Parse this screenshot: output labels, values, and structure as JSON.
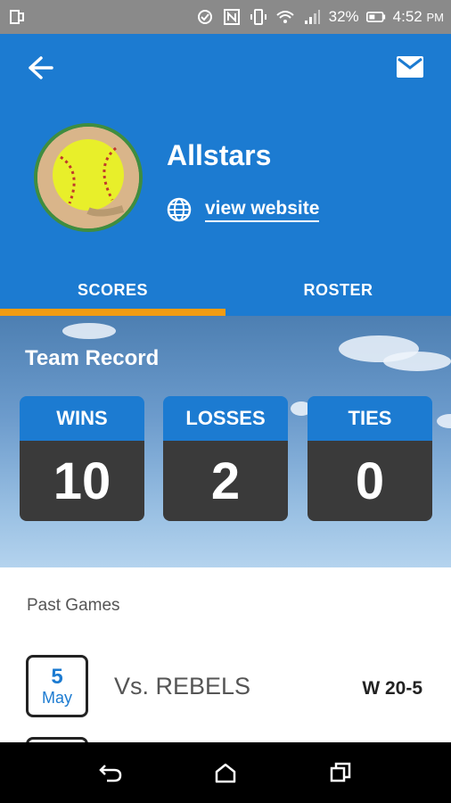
{
  "status_bar": {
    "battery_percent": "32%",
    "time": "4:52",
    "time_suffix": "PM"
  },
  "header": {
    "team_name": "Allstars",
    "website_label": "view website",
    "colors": {
      "header_bg": "#1c7bd1",
      "tab_indicator": "#f39c12"
    }
  },
  "tabs": [
    {
      "label": "SCORES",
      "active": true
    },
    {
      "label": "ROSTER",
      "active": false
    }
  ],
  "record": {
    "title": "Team Record",
    "stats": [
      {
        "label": "WINS",
        "value": "10"
      },
      {
        "label": "LOSSES",
        "value": "2"
      },
      {
        "label": "TIES",
        "value": "0"
      }
    ]
  },
  "past_games": {
    "title": "Past Games",
    "games": [
      {
        "day": "5",
        "month": "May",
        "opponent": "Vs. REBELS",
        "result": "W 20-5"
      }
    ]
  },
  "icons": {
    "back": "arrow-left-icon",
    "mail": "mail-icon",
    "globe": "globe-icon",
    "nav_back": "nav-back-icon",
    "nav_home": "nav-home-icon",
    "nav_recents": "nav-recents-icon"
  }
}
